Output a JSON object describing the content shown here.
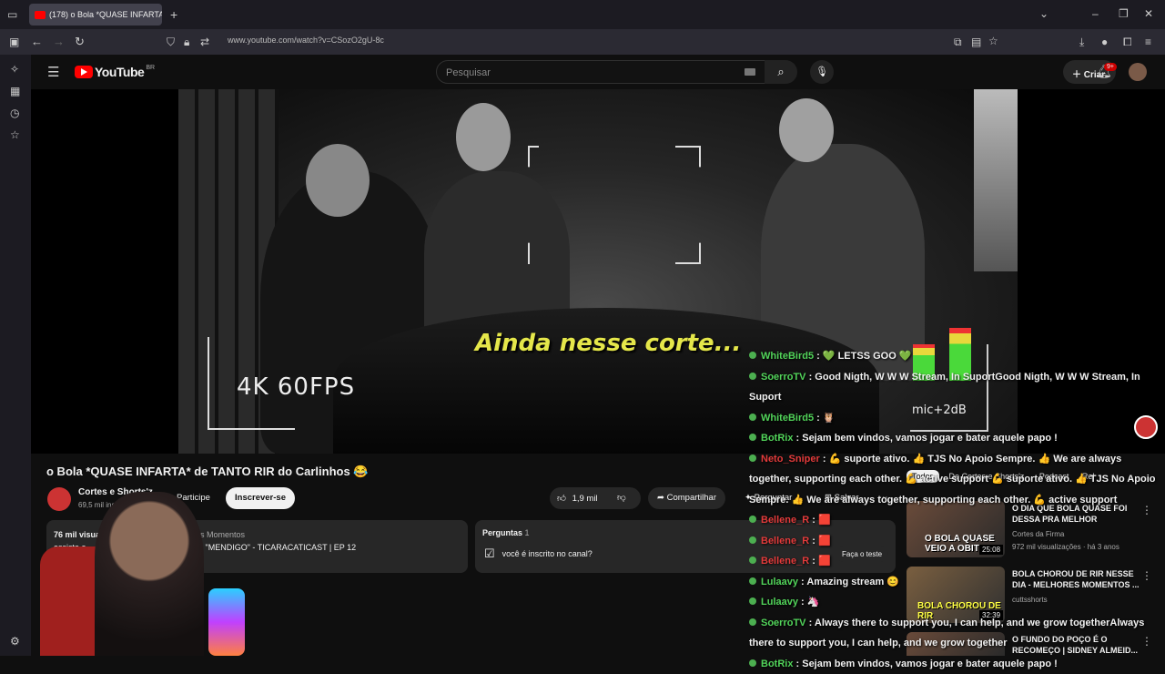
{
  "browser": {
    "tab_title": "(178) o Bola *QUASE INFARTA",
    "url": "www.youtube.com/watch?v=CSozO2gU-8c"
  },
  "youtube": {
    "logo": "YouTube",
    "country": "BR",
    "search_placeholder": "Pesquisar",
    "create_label": "Criar",
    "notif_count": "9+"
  },
  "video": {
    "overlay_caption": "Ainda nesse corte...",
    "quality_overlay": "4K   60FPS",
    "mic_label": "mic+2dB"
  },
  "meta": {
    "title": "o Bola *QUASE INFARTA* de TANTO RIR do Carlinhos 😂",
    "channel": "Cortes e Shorts'z",
    "subscribers": "69,5 mil ins",
    "join_label": "Participe",
    "subscribe_label": "Inscrever-se",
    "likes": "1,9 mil",
    "share_label": "Compartilhar",
    "ask_label": "Perguntar",
    "save_label": "Salvar"
  },
  "description": {
    "views": "76 mil visua",
    "chapters": "lhores Momentos",
    "line2a": "assista a",
    "line2b": "INHOS \"MENDIGO\" - TICARACATICAST | EP 12",
    "more": "...mais"
  },
  "questions": {
    "label": "Perguntas",
    "count": "1",
    "item": "você é inscrito no canal?",
    "test_label": "Faça o teste"
  },
  "comments_count": "30",
  "chips": [
    "Todos",
    "De Cortes e Shorts'z",
    "Podcast",
    "Rel"
  ],
  "recommendations": [
    {
      "title": "O DIA QUE BOLA QUASE FOI DESSA PRA MELHOR",
      "channel": "Cortes da Firma",
      "stats": "972 mil visualizações · há 3 anos",
      "duration": "25:08",
      "thumb_text": "O BOLA QUASE VEIO A OBITO"
    },
    {
      "title": "BOLA CHOROU DE RIR NESSE DIA - MELHORES MOMENTOS ...",
      "channel": "cuttsshorts",
      "stats": "",
      "duration": "32:39",
      "thumb_text": "BOLA CHOROU DE RIR"
    },
    {
      "title": "O FUNDO DO POÇO É O RECOMEÇO | SIDNEY ALMEID...",
      "channel": "",
      "stats": "",
      "duration": "",
      "thumb_text": ""
    }
  ],
  "chat": [
    {
      "user": "WhiteBird5",
      "cls": "n",
      "msg": " : 💚 LETSS GOO 💚"
    },
    {
      "user": "SoerroTV",
      "cls": "n",
      "msg": " : Good Nigth, W W W Stream, In SuportGood Nigth, W W W Stream, In Suport"
    },
    {
      "user": "WhiteBird5",
      "cls": "n",
      "msg": " : 🦉"
    },
    {
      "user": "BotRix",
      "cls": "n",
      "msg": " : Sejam bem vindos, vamos jogar e bater aquele papo !"
    },
    {
      "user": "Neto_Sniper",
      "cls": "r",
      "msg": " : 💪 suporte ativo. 👍 TJS No Apoio Sempre. 👍 We are always together, supporting each other. 💪 active support 💪 suporte ativo. 👍 TJS No Apoio Sempre. 👍 We are always together, supporting each other. 💪 active support"
    },
    {
      "user": "Bellene_R",
      "cls": "r",
      "msg": " : 🟥"
    },
    {
      "user": "Bellene_R",
      "cls": "r",
      "msg": " : 🟥"
    },
    {
      "user": "Bellene_R",
      "cls": "r",
      "msg": " : 🟥"
    },
    {
      "user": "Lulaavy",
      "cls": "n",
      "msg": " : Amazing stream 😊"
    },
    {
      "user": "Lulaavy",
      "cls": "n",
      "msg": " : 🦄"
    },
    {
      "user": "SoerroTV",
      "cls": "n",
      "msg": " : Always there to support you, I can help, and we grow togetherAlways there to support you, I can help, and we grow together"
    },
    {
      "user": "BotRix",
      "cls": "n",
      "msg": " : Sejam bem vindos, vamos jogar e bater aquele papo !"
    }
  ]
}
